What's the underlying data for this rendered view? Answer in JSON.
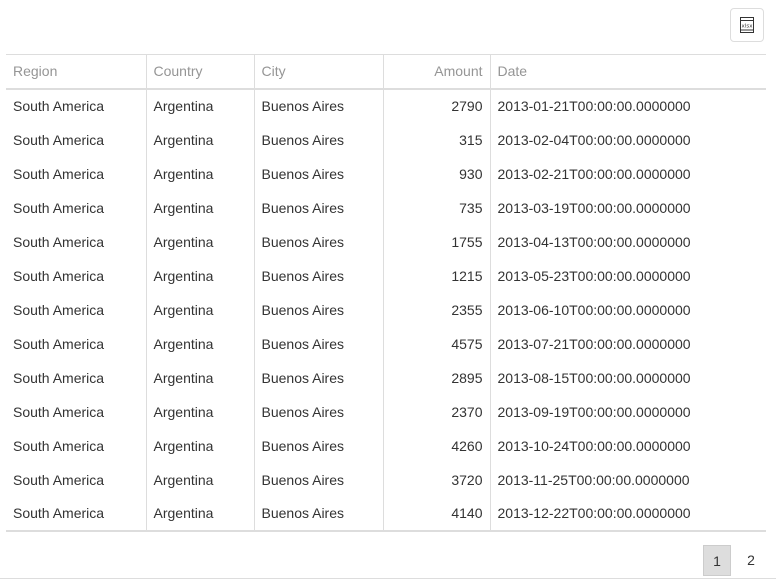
{
  "toolbar": {
    "export_icon": "xlsx-export-icon",
    "export_icon_text": "xlsx"
  },
  "grid": {
    "columns": [
      "Region",
      "Country",
      "City",
      "Amount",
      "Date"
    ],
    "rows": [
      [
        "South America",
        "Argentina",
        "Buenos Aires",
        "2790",
        "2013-01-21T00:00:00.0000000"
      ],
      [
        "South America",
        "Argentina",
        "Buenos Aires",
        "315",
        "2013-02-04T00:00:00.0000000"
      ],
      [
        "South America",
        "Argentina",
        "Buenos Aires",
        "930",
        "2013-02-21T00:00:00.0000000"
      ],
      [
        "South America",
        "Argentina",
        "Buenos Aires",
        "735",
        "2013-03-19T00:00:00.0000000"
      ],
      [
        "South America",
        "Argentina",
        "Buenos Aires",
        "1755",
        "2013-04-13T00:00:00.0000000"
      ],
      [
        "South America",
        "Argentina",
        "Buenos Aires",
        "1215",
        "2013-05-23T00:00:00.0000000"
      ],
      [
        "South America",
        "Argentina",
        "Buenos Aires",
        "2355",
        "2013-06-10T00:00:00.0000000"
      ],
      [
        "South America",
        "Argentina",
        "Buenos Aires",
        "4575",
        "2013-07-21T00:00:00.0000000"
      ],
      [
        "South America",
        "Argentina",
        "Buenos Aires",
        "2895",
        "2013-08-15T00:00:00.0000000"
      ],
      [
        "South America",
        "Argentina",
        "Buenos Aires",
        "2370",
        "2013-09-19T00:00:00.0000000"
      ],
      [
        "South America",
        "Argentina",
        "Buenos Aires",
        "4260",
        "2013-10-24T00:00:00.0000000"
      ],
      [
        "South America",
        "Argentina",
        "Buenos Aires",
        "3720",
        "2013-11-25T00:00:00.0000000"
      ],
      [
        "South America",
        "Argentina",
        "Buenos Aires",
        "4140",
        "2013-12-22T00:00:00.0000000"
      ]
    ]
  },
  "pager": {
    "pages": [
      "1",
      "2"
    ],
    "current": "1"
  },
  "colors": {
    "border": "#dddddd",
    "header_text": "#959595",
    "cell_text": "#333333",
    "active_page_bg": "#dddddd"
  }
}
